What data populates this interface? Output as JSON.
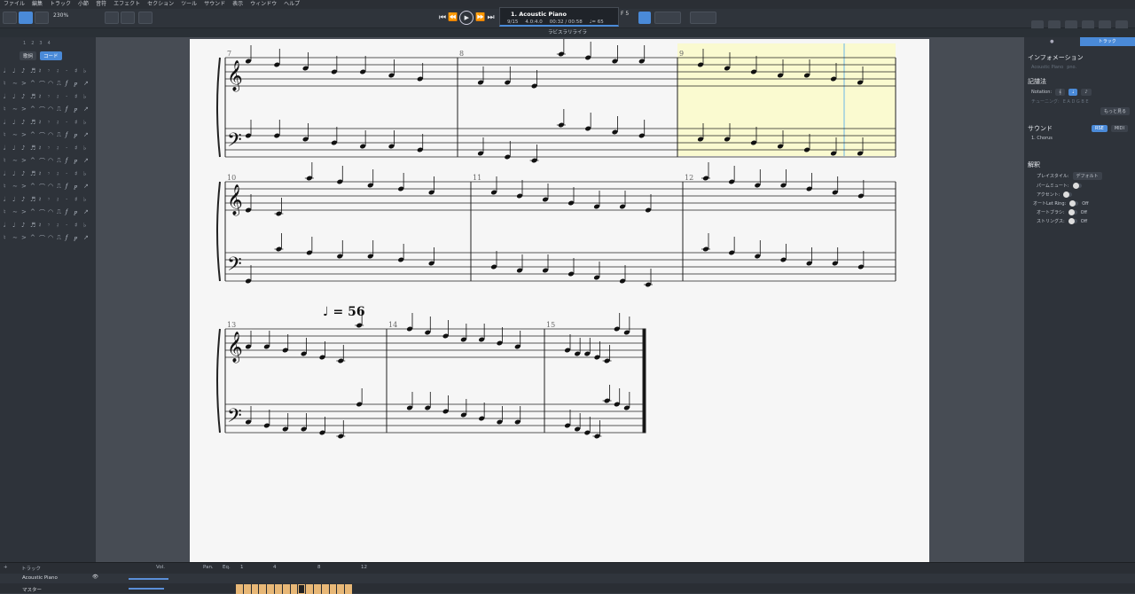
{
  "menu": [
    "ファイル",
    "編集",
    "トラック",
    "小節",
    "音符",
    "エフェクト",
    "セクション",
    "ツール",
    "サウンド",
    "表示",
    "ウィンドウ",
    "ヘルプ"
  ],
  "toolbar": {
    "zoom": "230%"
  },
  "lcd": {
    "track_title": "1. Acoustic Piano",
    "bar": "9/15",
    "signature": "4.0:4.0",
    "time": "00:32 / 00:58",
    "tempo": "♩= 65",
    "key": "F 5"
  },
  "score_title": "ラビスラリライラ",
  "left_panel": {
    "tabs": [
      "1",
      "2",
      "3",
      "4"
    ],
    "lyrics_label": "歌詞",
    "chords_label": "コード"
  },
  "score": {
    "tempo_marking": "♩ = 56",
    "bar_numbers": [
      "7",
      "8",
      "9",
      "10",
      "11",
      "12",
      "13",
      "14",
      "15"
    ]
  },
  "right_panel": {
    "tab_track": "トラック",
    "info_title": "インフォメーション",
    "info_instrument": "Acoustic Piano",
    "info_short": "pno.",
    "notation_title": "記譜法",
    "notation_label": "Notation:",
    "tuning_label": "チューニング:",
    "tuning_value": "E A D G B E",
    "more_label": "もっと見る",
    "sound_title": "サウンド",
    "sound_rse": "RSE",
    "sound_midi": "MIDI",
    "sound_item": "1. Chorus",
    "interp_title": "解釈",
    "play_style_label": "プレイスタイル:",
    "play_style_value": "デフォルト",
    "palm_mute_label": "パームミュート:",
    "accent_label": "アクセント:",
    "auto_let_ring_label": "オートLet Ring:",
    "auto_let_ring_value": "Off",
    "auto_brush_label": "オートブラシ:",
    "auto_brush_value": "Off",
    "stringing_label": "ストリングス:",
    "stringing_value": "Off"
  },
  "mixer": {
    "tracks_label": "トラック",
    "vol_label": "Vol.",
    "pan_label": "Pan.",
    "eq_label": "Eq.",
    "bar_markers": [
      "1",
      "4",
      "8",
      "12"
    ],
    "track_name": "Acoustic Piano",
    "master_label": "マスター",
    "bar_count": 15,
    "current_bar": 9
  }
}
